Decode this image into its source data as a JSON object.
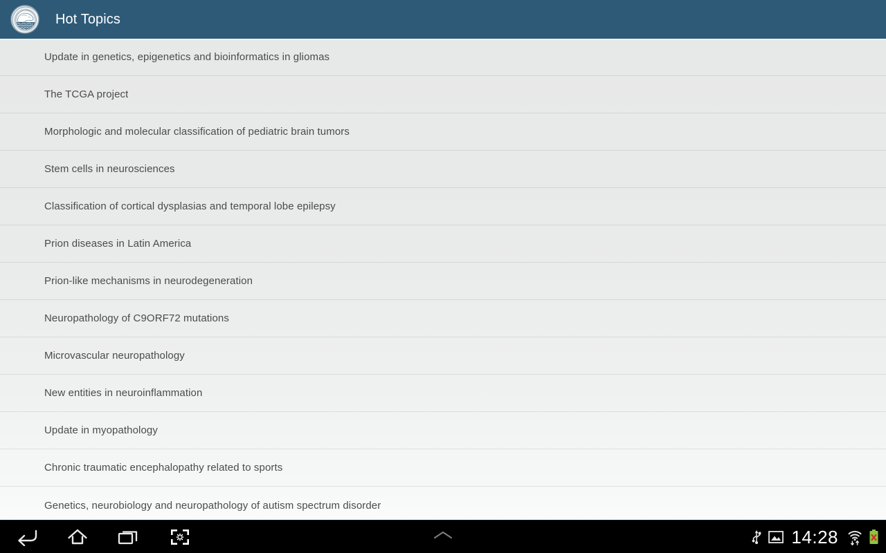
{
  "appbar": {
    "title": "Hot Topics",
    "logo_icon": "institution-seal-icon",
    "background_color": "#2e5a77",
    "title_color": "#ffffff"
  },
  "list": {
    "name": "hot-topics-list",
    "background_color": "#e9eaea",
    "text_color": "#4b4b4b",
    "items": [
      {
        "label": "Update in genetics, epigenetics and bioinformatics in gliomas"
      },
      {
        "label": "The TCGA project"
      },
      {
        "label": "Morphologic and molecular classification of pediatric brain tumors"
      },
      {
        "label": "Stem cells in neurosciences"
      },
      {
        "label": "Classification of cortical dysplasias and temporal lobe epilepsy"
      },
      {
        "label": "Prion diseases in Latin America"
      },
      {
        "label": "Prion-like mechanisms in neurodegeneration"
      },
      {
        "label": "Neuropathology of C9ORF72 mutations"
      },
      {
        "label": "Microvascular neuropathology"
      },
      {
        "label": "New entities in neuroinflammation"
      },
      {
        "label": "Update in myopathology"
      },
      {
        "label": "Chronic traumatic encephalopathy related to sports"
      },
      {
        "label": "Genetics, neurobiology and neuropathology of autism spectrum disorder"
      }
    ]
  },
  "navbar": {
    "background_color": "#000000",
    "buttons": [
      {
        "name": "back-icon",
        "label": "Back"
      },
      {
        "name": "home-icon",
        "label": "Home"
      },
      {
        "name": "recents-icon",
        "label": "Recent apps"
      },
      {
        "name": "screenshot-icon",
        "label": "Screenshot"
      }
    ],
    "ime_chevron": {
      "name": "chevron-up-icon",
      "label": "Show keyboard"
    }
  },
  "status": {
    "usb_icon": "usb-icon",
    "screenshot_capture_icon": "image-icon",
    "clock": "14:28",
    "wifi_icon": "wifi-transfer-icon",
    "battery_icon": "battery-error-icon",
    "battery_color": "#8cc63f",
    "battery_error_color": "#d0342c"
  }
}
